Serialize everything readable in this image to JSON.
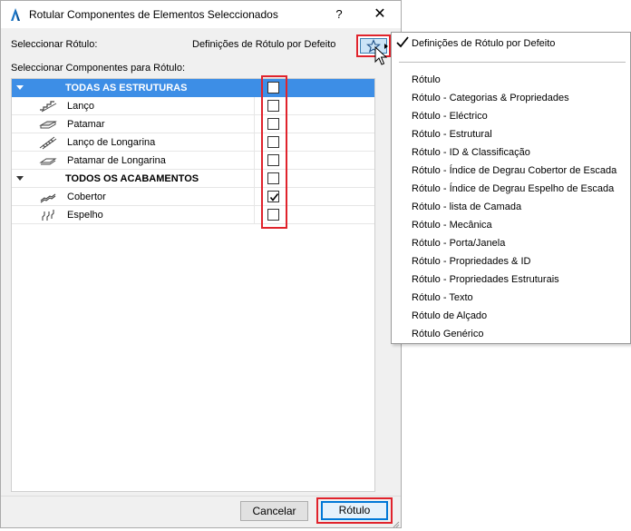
{
  "window": {
    "title": "Rotular Componentes de Elementos Seleccionados",
    "help_label": "?",
    "close_label": "✕"
  },
  "label_selector": {
    "label": "Seleccionar Rótulo:",
    "current_value": "Definições de Rótulo por Defeito",
    "favorites_icon": "star-icon"
  },
  "components": {
    "heading": "Seleccionar Componentes para Rótulo:",
    "categories": [
      {
        "label": "TODAS AS ESTRUTURAS",
        "checked": false,
        "selected": true,
        "items": [
          {
            "label": "Lanço",
            "icon": "flight-icon",
            "checked": false
          },
          {
            "label": "Patamar",
            "icon": "landing-icon",
            "checked": false
          },
          {
            "label": "Lanço de Longarina",
            "icon": "stringer-flight-icon",
            "checked": false
          },
          {
            "label": "Patamar de Longarina",
            "icon": "stringer-landing-icon",
            "checked": false
          }
        ]
      },
      {
        "label": "TODOS OS ACABAMENTOS",
        "checked": false,
        "selected": false,
        "items": [
          {
            "label": "Cobertor",
            "icon": "tread-icon",
            "checked": true
          },
          {
            "label": "Espelho",
            "icon": "riser-icon",
            "checked": false
          }
        ]
      }
    ]
  },
  "buttons": {
    "cancel": "Cancelar",
    "ok": "Rótulo"
  },
  "dropdown_menu": {
    "checked_item": "Definições de Rótulo por Defeito",
    "items": [
      "Rótulo",
      "Rótulo - Categorias & Propriedades",
      "Rótulo - Eléctrico",
      "Rótulo - Estrutural",
      "Rótulo - ID & Classificação",
      "Rótulo - Índice de Degrau Cobertor de Escada",
      "Rótulo - Índice de Degrau Espelho de Escada",
      "Rótulo - lista de Camada",
      "Rótulo - Mecânica",
      "Rótulo - Porta/Janela",
      "Rótulo - Propriedades & ID",
      "Rótulo - Propriedades Estruturais",
      "Rótulo - Texto",
      "Rótulo de Alçado",
      "Rótulo Genérico"
    ]
  },
  "colors": {
    "selection": "#3d8ee6",
    "highlight_box": "#e0232c",
    "default_button_border": "#0078d7"
  }
}
